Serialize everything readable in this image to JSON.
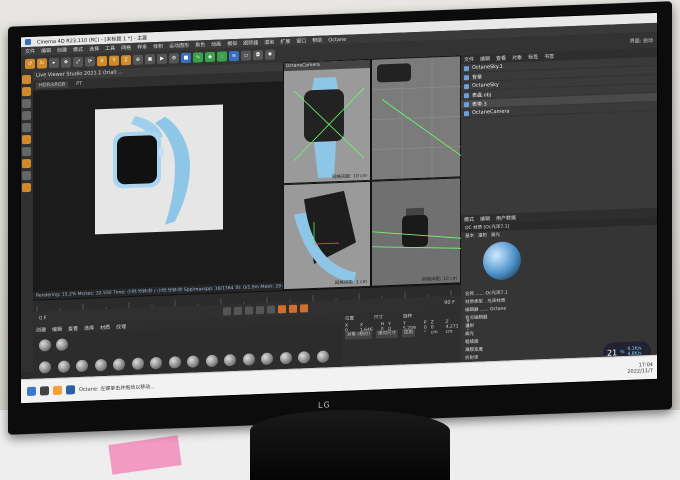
{
  "app": {
    "titlebar": "Cinema 4D R23.110 (RC) - [未标题 1 *] - 主要",
    "menu": [
      "文件",
      "编辑",
      "创建",
      "模式",
      "选择",
      "工具",
      "网格",
      "样条",
      "体积",
      "运动图形",
      "角色",
      "动画",
      "模拟",
      "跟踪器",
      "渲染",
      "扩展",
      "窗口",
      "帮助",
      "Octane"
    ],
    "layout_label": "界面: 启动"
  },
  "live_viewer": {
    "title": "Live Viewer Studio 2021.1 (trial) ...",
    "tools": [
      "HDR/sRGB",
      "",
      "PT"
    ],
    "status": "Rendering: 15.2%  Ms/sec: 32.550  Time: 小时:分钟:秒 / 小时:分钟:秒  Spp/maxspp: 16/1764  Tri: 0/1.9m  Mesh: 29  Hair: 0  RTX: on  GPU: 64"
  },
  "viewports": {
    "top_title": "OctaneCamera",
    "top_label": "网格间距: 10 cm",
    "side_label": "网格间距: 10 cm",
    "persp_label": "网格间距: 1 cm"
  },
  "objects": {
    "tabs": [
      "文件",
      "编辑",
      "查看",
      "对象",
      "标签",
      "书签"
    ],
    "items": [
      {
        "name": "OctaneSky.1",
        "selected": false
      },
      {
        "name": "背景",
        "selected": false
      },
      {
        "name": "OctaneSky",
        "selected": false
      },
      {
        "name": "表盘.obj",
        "selected": false
      },
      {
        "name": "表带.3",
        "selected": true
      },
      {
        "name": "OctaneCamera",
        "selected": false
      }
    ]
  },
  "attributes": {
    "header": [
      "模式",
      "编辑",
      "用户数据"
    ],
    "material_title": "OC 材质 [Oc光泽7.1]",
    "tabs": [
      "基本",
      "漫射",
      "高光"
    ],
    "rows": [
      "名称 ...... Oc光泽7.1",
      "材质类型 . 光泽材质",
      "编辑器 ...... Octane",
      "节点编辑器",
      "漫射",
      "高光",
      "粗糙度",
      "薄膜宽度",
      "折射率"
    ]
  },
  "playback": {
    "frame_start": "0 F",
    "frame_end": "90 F"
  },
  "materials": {
    "tabs": [
      "创建",
      "编辑",
      "查看",
      "选择",
      "材质",
      "纹理"
    ],
    "count": 18
  },
  "coords": {
    "headers": [
      "位置",
      "尺寸",
      "旋转"
    ],
    "rows": [
      [
        "X 0 cm",
        "X 1.646 cm",
        "H 0 °"
      ],
      [
        "Y 0 cm",
        "Y 5.209 cm",
        "P 0 °"
      ],
      [
        "Z 0 cm",
        "Z 4.271 cm",
        "B 0 °"
      ]
    ],
    "buttons": [
      "对象 (相对)",
      "绝对尺寸",
      "应用"
    ]
  },
  "perf": {
    "value": "21",
    "unit": "%",
    "up": "0.1K/s",
    "down": "4.8K/s"
  },
  "taskbar": {
    "hint": "Octane: 左键单击并拖动以移动...",
    "time": "17:04",
    "date": "2022/11/7"
  },
  "monitor_brand": "LG",
  "colors": {
    "accent": "#d08a2a",
    "selection": "#4a4a4a",
    "watch": "#8ec6e8"
  }
}
